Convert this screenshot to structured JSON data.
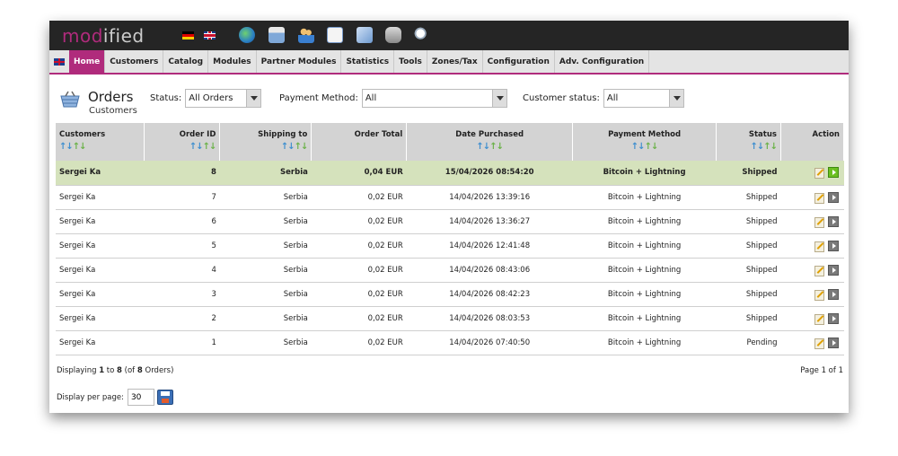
{
  "brand": {
    "logo_mod": "mod",
    "logo_ified": "ified"
  },
  "menu": [
    "Home",
    "Customers",
    "Catalog",
    "Modules",
    "Partner Modules",
    "Statistics",
    "Tools",
    "Zones/Tax",
    "Configuration",
    "Adv. Configuration"
  ],
  "page": {
    "title": "Orders",
    "subtitle": "Customers"
  },
  "filters": {
    "status_label": "Status:",
    "status_value": "All Orders",
    "payment_label": "Payment Method:",
    "payment_value": "All",
    "customer_label": "Customer status:",
    "customer_value": "All"
  },
  "columns": {
    "customers": "Customers",
    "order_id": "Order ID",
    "shipping": "Shipping to",
    "total": "Order Total",
    "date": "Date Purchased",
    "payment": "Payment Method",
    "status": "Status",
    "action": "Action"
  },
  "orders": [
    {
      "customer": "Sergei Ka",
      "id": "8",
      "ship": "Serbia",
      "total": "0,04 EUR",
      "date": "15/04/2026 08:54:20",
      "payment": "Bitcoin + Lightning",
      "status": "Shipped"
    },
    {
      "customer": "Sergei Ka",
      "id": "7",
      "ship": "Serbia",
      "total": "0,02 EUR",
      "date": "14/04/2026 13:39:16",
      "payment": "Bitcoin + Lightning",
      "status": "Shipped"
    },
    {
      "customer": "Sergei Ka",
      "id": "6",
      "ship": "Serbia",
      "total": "0,02 EUR",
      "date": "14/04/2026 13:36:27",
      "payment": "Bitcoin + Lightning",
      "status": "Shipped"
    },
    {
      "customer": "Sergei Ka",
      "id": "5",
      "ship": "Serbia",
      "total": "0,02 EUR",
      "date": "14/04/2026 12:41:48",
      "payment": "Bitcoin + Lightning",
      "status": "Shipped"
    },
    {
      "customer": "Sergei Ka",
      "id": "4",
      "ship": "Serbia",
      "total": "0,02 EUR",
      "date": "14/04/2026 08:43:06",
      "payment": "Bitcoin + Lightning",
      "status": "Shipped"
    },
    {
      "customer": "Sergei Ka",
      "id": "3",
      "ship": "Serbia",
      "total": "0,02 EUR",
      "date": "14/04/2026 08:42:23",
      "payment": "Bitcoin + Lightning",
      "status": "Shipped"
    },
    {
      "customer": "Sergei Ka",
      "id": "2",
      "ship": "Serbia",
      "total": "0,02 EUR",
      "date": "14/04/2026 08:03:53",
      "payment": "Bitcoin + Lightning",
      "status": "Shipped"
    },
    {
      "customer": "Sergei Ka",
      "id": "1",
      "ship": "Serbia",
      "total": "0,02 EUR",
      "date": "14/04/2026 07:40:50",
      "payment": "Bitcoin + Lightning",
      "status": "Pending"
    }
  ],
  "footer": {
    "displaying_prefix": "Displaying ",
    "from": "1",
    "to_word": " to ",
    "to": "8",
    "of_prefix": " (of ",
    "total": "8",
    "of_suffix": " Orders)",
    "page_info": "Page 1 of 1",
    "per_page_label": "Display per page:",
    "per_page_value": "30"
  },
  "icons": [
    "globe-icon",
    "orders-basket-icon",
    "customers-icon",
    "configuration-icon",
    "documents-icon",
    "database-icon",
    "search-icon",
    "edit-icon",
    "details-arrow-icon",
    "save-icon"
  ],
  "colors": {
    "brand": "#b02b7c",
    "selected_row": "#d5e2bc",
    "header_bg": "#d3d3d3",
    "topbar": "#252525"
  }
}
